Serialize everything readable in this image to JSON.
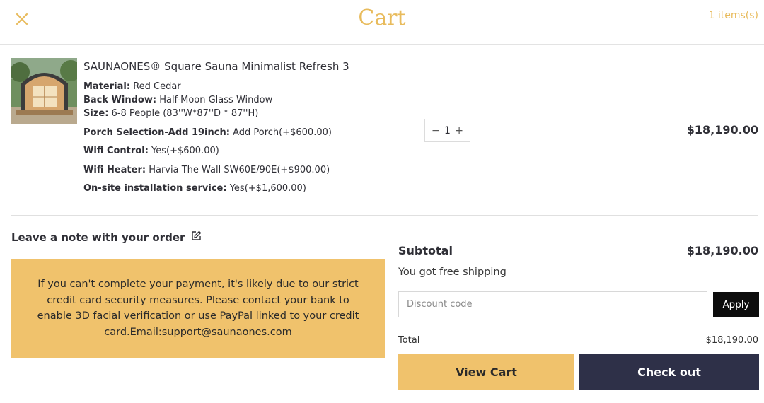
{
  "header": {
    "title": "Cart",
    "items_count": "1 items(s)",
    "close_icon": "close-icon"
  },
  "product": {
    "image_icon": "sauna-product-image",
    "name": "SAUNAONES® Square Sauna Minimalist Refresh 3",
    "options": [
      {
        "label": "Material:",
        "value": "Red Cedar"
      },
      {
        "label": "Back Window:",
        "value": "Half-Moon Glass Window"
      },
      {
        "label": "Size:",
        "value": "6-8 People (83''W*87''D * 87''H)"
      },
      {
        "label": "Porch Selection-Add 19inch:",
        "value": "Add Porch(+$600.00)"
      },
      {
        "label": "Wifi Control:",
        "value": "Yes(+$600.00)"
      },
      {
        "label": "Wifi Heater:",
        "value": "Harvia The Wall SW60E/90E(+$900.00)"
      },
      {
        "label": "On-site installation service:",
        "value": "Yes(+$1,600.00)"
      }
    ],
    "quantity": {
      "minus": "−",
      "value": "1",
      "plus": "+"
    },
    "price": "$18,190.00"
  },
  "note": {
    "label": "Leave a note with your order",
    "icon": "edit-icon"
  },
  "notice": {
    "text": "If you can't complete your payment, it's likely due to our strict credit card security measures. Please contact your bank to enable 3D facial verification or use PayPal linked to your credit card.Email:support@saunaones.com"
  },
  "summary": {
    "subtotal_label": "Subtotal",
    "subtotal_value": "$18,190.00",
    "shipping_text": "You got free shipping",
    "discount_placeholder": "Discount code",
    "apply_label": "Apply",
    "total_label": "Total",
    "total_value": "$18,190.00",
    "view_cart_label": "View Cart",
    "checkout_label": "Check out"
  },
  "colors": {
    "accent_gold": "#e8bb5c",
    "notice_bg": "#f0c26c",
    "checkout_bg": "#2e3048"
  }
}
